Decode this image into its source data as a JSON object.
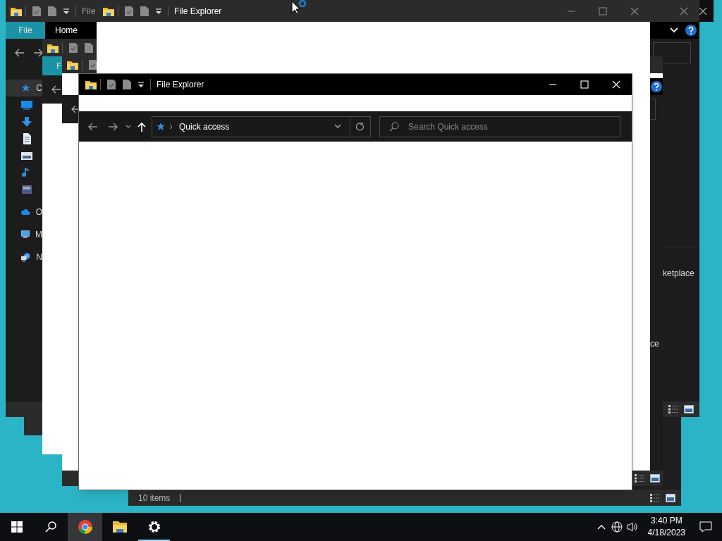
{
  "back_window": {
    "title": "File",
    "ribbon_tabs": [
      {
        "label": "File",
        "selected": true
      },
      {
        "label": "Home",
        "selected": false
      }
    ],
    "nav_items": [
      {
        "kind": "star",
        "label": "C",
        "selected": true
      },
      {
        "kind": "desktop",
        "selected": false
      },
      {
        "kind": "download",
        "selected": false
      },
      {
        "kind": "documents",
        "selected": false
      },
      {
        "kind": "pictures",
        "selected": false
      },
      {
        "kind": "music",
        "selected": false
      },
      {
        "kind": "videos",
        "selected": false
      },
      {
        "kind": "cloud",
        "label": "O",
        "selected": false
      },
      {
        "kind": "pc",
        "label": "M",
        "selected": false
      },
      {
        "kind": "network",
        "label": "N",
        "selected": false
      }
    ],
    "side_text": "ketplace"
  },
  "status_window": {
    "status": "10 items"
  },
  "stacked_window": {
    "ribbon_tab": {
      "label": "F",
      "selected": true
    }
  },
  "inner_window": {
    "side_text": "ce"
  },
  "top_window": {
    "title": "File Explorer"
  },
  "front_window": {
    "title": "File Explorer",
    "address": "Quick access",
    "search": {
      "placeholder": "Search Quick access"
    }
  },
  "taskbar": {
    "apps": [
      {
        "kind": "chrome",
        "hovered": true,
        "running": false
      },
      {
        "kind": "explorer",
        "hovered": false,
        "running": false
      },
      {
        "kind": "settings",
        "hovered": false,
        "running": true
      }
    ],
    "time": "3:40 PM",
    "date": "4/18/2023"
  }
}
